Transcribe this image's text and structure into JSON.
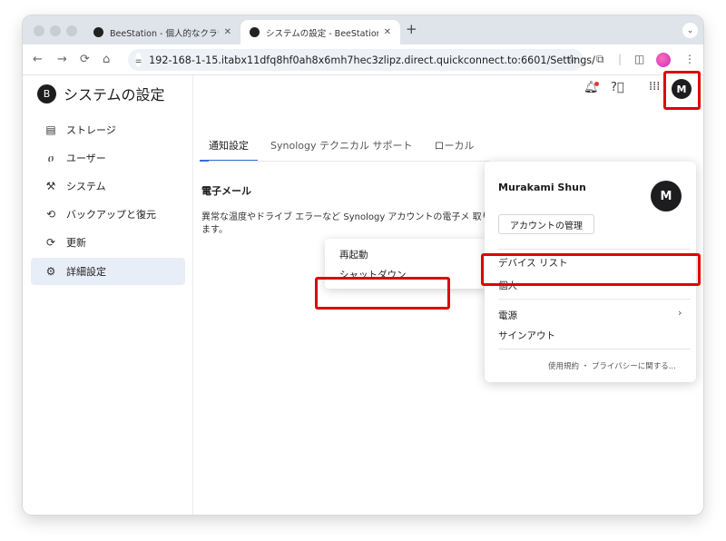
{
  "browser": {
    "tabs": [
      {
        "title": "BeeStation - 個人的なクラウド",
        "close": "✕"
      },
      {
        "title": "システムの設定 - BeeStation",
        "close": "✕"
      }
    ],
    "new_tab": "+",
    "tab_menu": "⌄",
    "url": "192-168-1-15.itabx11dfq8hf0ah8x6mh7hec3zlipz.direct.quickconnect.to:6601/Settings/",
    "site_info_icon": "tune-icon",
    "nav": {
      "back": "←",
      "forward": "→",
      "reload": "⟳",
      "home": "⌂"
    }
  },
  "app": {
    "title": "システムの設定",
    "logo_letter": "B"
  },
  "sidebar": {
    "items": [
      {
        "label": "ストレージ",
        "icon": "storage-icon",
        "glyph": "▤"
      },
      {
        "label": "ユーザー",
        "icon": "user-icon",
        "glyph": "ዐ"
      },
      {
        "label": "システム",
        "icon": "wrench-icon",
        "glyph": "⚒"
      },
      {
        "label": "バックアップと復元",
        "icon": "backup-icon",
        "glyph": "⟲"
      },
      {
        "label": "更新",
        "icon": "refresh-icon",
        "glyph": "⟳"
      },
      {
        "label": "詳細設定",
        "icon": "advanced-settings-icon",
        "glyph": "⚙"
      }
    ],
    "selected": "詳細設定"
  },
  "settings_tabs": [
    "通知設定",
    "Synology テクニカル サポート",
    "ローカル"
  ],
  "section": {
    "title": "電子メール",
    "description": "異常な温度やドライブ エラーなど Synology アカウントの電子メ 取ります。"
  },
  "power_submenu": {
    "items": [
      "再起動",
      "シャットダウン"
    ]
  },
  "account_dropdown": {
    "user_name": "Murakami Shun",
    "avatar_letter": "M",
    "manage_account": "アカウントの管理",
    "items": [
      "デバイス リスト",
      "個人",
      "電源",
      "サインアウト"
    ],
    "power_chevron": "›",
    "footer": "使用規約 ・ プライバシーに関する..."
  },
  "topbar": {
    "avatar_letter": "M"
  },
  "colors": {
    "highlight": "#e00000",
    "accent": "#3570d6",
    "avatar_bg": "#1d1d1f"
  }
}
